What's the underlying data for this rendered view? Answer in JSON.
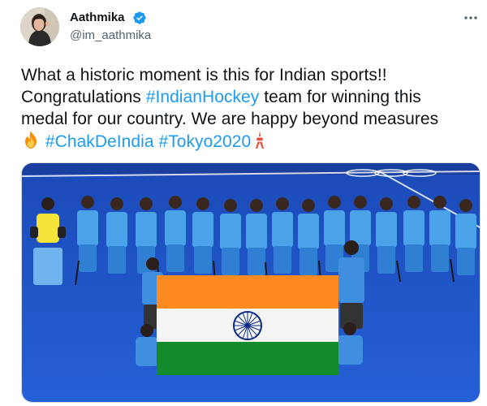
{
  "tweet": {
    "author": {
      "display_name": "Aathmika",
      "handle": "@im_aathmika",
      "verified": true,
      "verified_icon": "verified-badge-icon",
      "avatar": "profile-avatar"
    },
    "more_icon": "more-horizontal-icon",
    "text": {
      "line1": "What a historic moment is this for Indian sports!!",
      "line2_prefix": "Congratulations ",
      "hashtag_indian_hockey": "#IndianHockey",
      "line2_suffix": " team for winning this",
      "line3": "medal for our country. We are happy beyond measures",
      "fire_emoji_icon": "fire-emoji-icon",
      "hashtag_chak_de_india": "#ChakDeIndia",
      "hashtag_tokyo2020": "#Tokyo2020",
      "tower_emoji_icon": "tokyo-tower-emoji-icon"
    },
    "media": {
      "image": "team-photo-indian-hockey-with-flag"
    },
    "colors": {
      "accent": "#1d9bf0",
      "text": "#0f1419",
      "secondary_text": "#536471",
      "turf": "#1f54c4",
      "saffron": "#ff8a1f",
      "india_green": "#138a2c",
      "chakra": "#0a2a8a"
    }
  }
}
